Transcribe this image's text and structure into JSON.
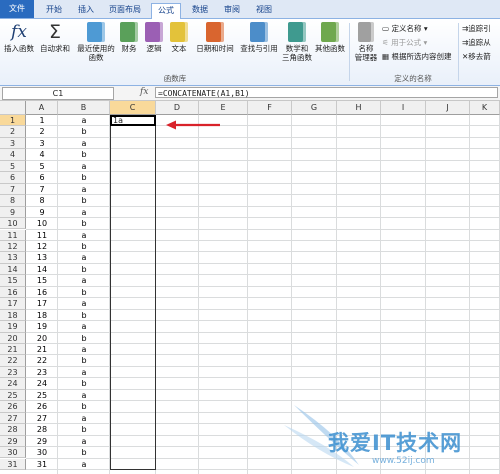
{
  "tabs": [
    "文件",
    "开始",
    "插入",
    "页面布局",
    "公式",
    "数据",
    "审阅",
    "视图"
  ],
  "active_tab": "公式",
  "ribbon": {
    "buttons": [
      {
        "label": "插入函数",
        "icon": "fx-icon"
      },
      {
        "label": "自动求和",
        "icon": "sigma-icon"
      },
      {
        "label": "最近使用的\n函数",
        "icon": "book-icon"
      },
      {
        "label": "财务",
        "icon": "book-icon"
      },
      {
        "label": "逻辑",
        "icon": "book-icon"
      },
      {
        "label": "文本",
        "icon": "book-icon"
      },
      {
        "label": "日期和时间",
        "icon": "book-icon"
      },
      {
        "label": "查找与引用",
        "icon": "book-icon"
      },
      {
        "label": "数学和\n三角函数",
        "icon": "book-icon"
      },
      {
        "label": "其他函数",
        "icon": "book-icon"
      },
      {
        "label": "名称\n管理器",
        "icon": "book-icon"
      }
    ],
    "group_function_library": "函数库",
    "group_defined_names": "定义的名称",
    "define_name": "定义名称",
    "use_in_formula": "用于公式",
    "create_from_selection": "根据所选内容创建",
    "trace_precedents": "追踪引",
    "trace_dependents": "追踪从",
    "remove_arrows": "移去箭"
  },
  "formula_bar": {
    "name_box": "C1",
    "fx": "fx",
    "formula": "=CONCATENATE(A1,B1)"
  },
  "columns": [
    "A",
    "B",
    "C",
    "D",
    "E",
    "F",
    "G",
    "H",
    "I",
    "J",
    "K"
  ],
  "selected_column": "C",
  "rows": [
    {
      "n": "1",
      "a": "1",
      "b": "a"
    },
    {
      "n": "2",
      "a": "2",
      "b": "b"
    },
    {
      "n": "3",
      "a": "3",
      "b": "a"
    },
    {
      "n": "4",
      "a": "4",
      "b": "b"
    },
    {
      "n": "5",
      "a": "5",
      "b": "a"
    },
    {
      "n": "6",
      "a": "6",
      "b": "b"
    },
    {
      "n": "7",
      "a": "7",
      "b": "a"
    },
    {
      "n": "8",
      "a": "8",
      "b": "b"
    },
    {
      "n": "9",
      "a": "9",
      "b": "a"
    },
    {
      "n": "10",
      "a": "10",
      "b": "b"
    },
    {
      "n": "11",
      "a": "11",
      "b": "a"
    },
    {
      "n": "12",
      "a": "12",
      "b": "b"
    },
    {
      "n": "13",
      "a": "13",
      "b": "a"
    },
    {
      "n": "14",
      "a": "14",
      "b": "b"
    },
    {
      "n": "15",
      "a": "15",
      "b": "a"
    },
    {
      "n": "16",
      "a": "16",
      "b": "b"
    },
    {
      "n": "17",
      "a": "17",
      "b": "a"
    },
    {
      "n": "18",
      "a": "18",
      "b": "b"
    },
    {
      "n": "19",
      "a": "19",
      "b": "a"
    },
    {
      "n": "20",
      "a": "20",
      "b": "b"
    },
    {
      "n": "21",
      "a": "21",
      "b": "a"
    },
    {
      "n": "22",
      "a": "22",
      "b": "b"
    },
    {
      "n": "23",
      "a": "23",
      "b": "a"
    },
    {
      "n": "24",
      "a": "24",
      "b": "b"
    },
    {
      "n": "25",
      "a": "25",
      "b": "a"
    },
    {
      "n": "26",
      "a": "26",
      "b": "b"
    },
    {
      "n": "27",
      "a": "27",
      "b": "a"
    },
    {
      "n": "28",
      "a": "28",
      "b": "b"
    },
    {
      "n": "29",
      "a": "29",
      "b": "a"
    },
    {
      "n": "30",
      "a": "30",
      "b": "b"
    },
    {
      "n": "31",
      "a": "31",
      "b": "a"
    }
  ],
  "c1_value": "1a",
  "watermark": {
    "text": "我爱IT技术网",
    "url": "www.52ij.com"
  },
  "colors": {
    "accent": "#2a6bbf",
    "arrow": "#d9222a",
    "selected_header": "#f9d99a"
  }
}
